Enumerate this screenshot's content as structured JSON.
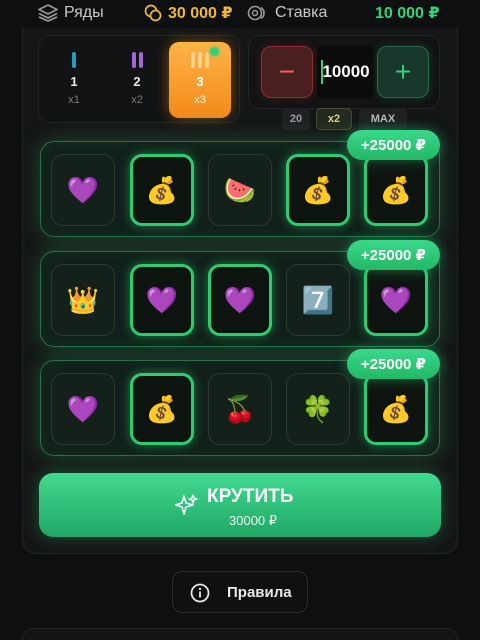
{
  "topbar": {
    "rows_label": "Ряды",
    "balance": "30 000 ₽",
    "bet_label": "Ставка",
    "bet_value": "10 000 ₽"
  },
  "rows_selector": {
    "options": [
      {
        "count": "1",
        "multiplier": "x1",
        "color": "#2a9db5",
        "bars": 1
      },
      {
        "count": "2",
        "multiplier": "x2",
        "color": "#a06ad6",
        "bars": 2
      },
      {
        "count": "3",
        "multiplier": "x3",
        "color": "#ffd08a",
        "bars": 3,
        "selected": true
      }
    ]
  },
  "bet": {
    "minus_label": "−",
    "plus_label": "+",
    "amount": "10000",
    "quick": [
      "20",
      "x2",
      "MAX"
    ]
  },
  "reels": [
    {
      "win": "+25000 ₽",
      "cells": [
        {
          "icon": "💜",
          "name": "purple-heart-icon",
          "win": false
        },
        {
          "icon": "💰",
          "name": "money-bag-icon",
          "win": true
        },
        {
          "icon": "🍉",
          "name": "watermelon-icon",
          "win": false
        },
        {
          "icon": "💰",
          "name": "money-bag-icon",
          "win": true
        },
        {
          "icon": "💰",
          "name": "money-bag-icon",
          "win": true
        }
      ]
    },
    {
      "win": "+25000 ₽",
      "cells": [
        {
          "icon": "👑",
          "name": "crown-icon",
          "win": false
        },
        {
          "icon": "💜",
          "name": "purple-heart-icon",
          "win": true
        },
        {
          "icon": "💜",
          "name": "purple-heart-icon",
          "win": true
        },
        {
          "icon": "7️⃣",
          "name": "seven-icon",
          "win": false
        },
        {
          "icon": "💜",
          "name": "purple-heart-icon",
          "win": true
        }
      ]
    },
    {
      "win": "+25000 ₽",
      "cells": [
        {
          "icon": "💜",
          "name": "purple-heart-icon",
          "win": false
        },
        {
          "icon": "💰",
          "name": "money-bag-icon",
          "win": true
        },
        {
          "icon": "🍒",
          "name": "cherries-icon",
          "win": false
        },
        {
          "icon": "🍀",
          "name": "clover-icon",
          "win": false
        },
        {
          "icon": "💰",
          "name": "money-bag-icon",
          "win": true
        }
      ]
    }
  ],
  "spin": {
    "label": "КРУТИТЬ",
    "amount": "30000 ₽"
  },
  "rules": {
    "label": "Правила"
  },
  "colors": {
    "accent_green": "#2ecc71",
    "balance_gold": "#f0b83a",
    "selected_orange": "#f28a1a",
    "minus_red": "#ff5a5a"
  }
}
